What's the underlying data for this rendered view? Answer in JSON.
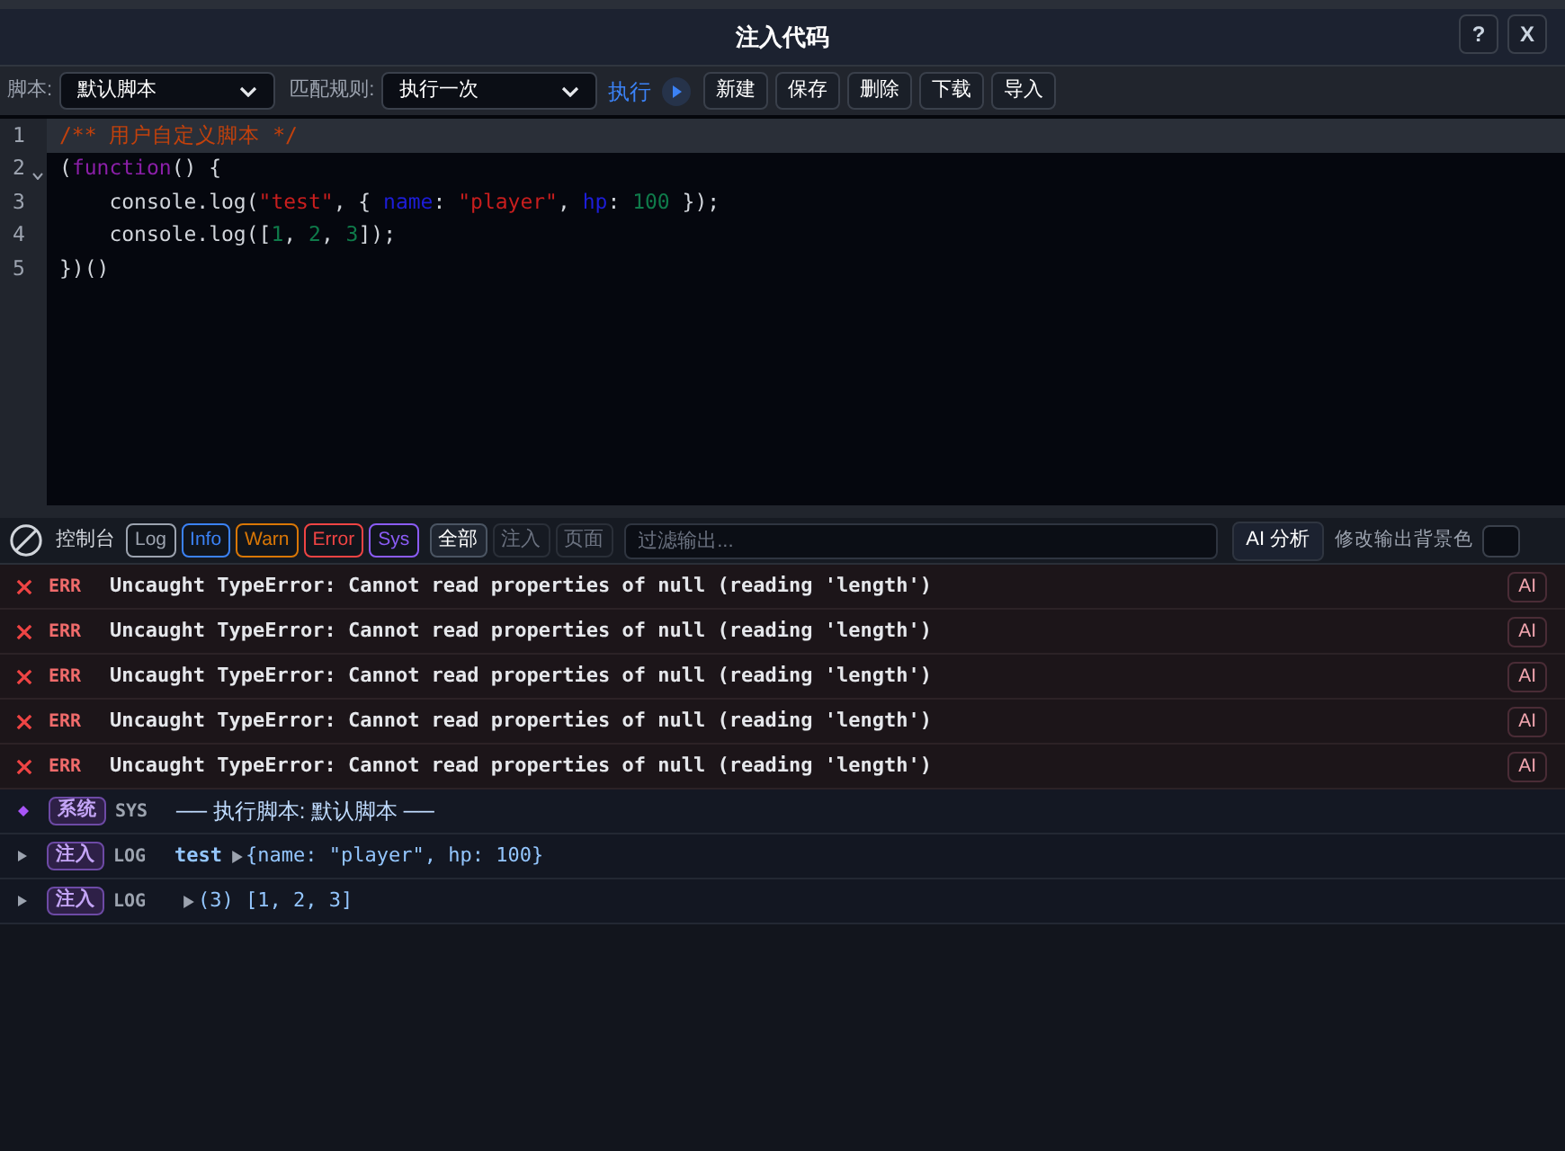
{
  "window": {
    "title": "注入代码",
    "buttons": [
      "?",
      "X"
    ]
  },
  "toolbar": {
    "script_label": "脚本:",
    "script_value": "默认脚本",
    "rule_label": "匹配规则:",
    "rule_value": "执行一次",
    "run_label": "执行",
    "buttons": [
      "新建",
      "保存",
      "删除",
      "下载",
      "导入"
    ]
  },
  "editor": {
    "lines": [
      {
        "number": "1",
        "active": true,
        "foldable": false,
        "tokens": [
          {
            "kind": "comment",
            "text": "/** 用户自定义脚本 */"
          }
        ]
      },
      {
        "number": "2",
        "active": false,
        "foldable": true,
        "tokens": [
          {
            "kind": "plain",
            "text": "("
          },
          {
            "kind": "keyword",
            "text": "function"
          },
          {
            "kind": "plain",
            "text": "() {"
          }
        ]
      },
      {
        "number": "3",
        "active": false,
        "foldable": false,
        "tokens": [
          {
            "kind": "plain",
            "text": "    console.log("
          },
          {
            "kind": "string",
            "text": "\"test\""
          },
          {
            "kind": "plain",
            "text": ", { "
          },
          {
            "kind": "property",
            "text": "name"
          },
          {
            "kind": "plain",
            "text": ": "
          },
          {
            "kind": "string",
            "text": "\"player\""
          },
          {
            "kind": "plain",
            "text": ", "
          },
          {
            "kind": "property",
            "text": "hp"
          },
          {
            "kind": "plain",
            "text": ": "
          },
          {
            "kind": "number",
            "text": "100"
          },
          {
            "kind": "plain",
            "text": " });"
          }
        ]
      },
      {
        "number": "4",
        "active": false,
        "foldable": false,
        "tokens": [
          {
            "kind": "plain",
            "text": "    console.log(["
          },
          {
            "kind": "number",
            "text": "1"
          },
          {
            "kind": "plain",
            "text": ", "
          },
          {
            "kind": "number",
            "text": "2"
          },
          {
            "kind": "plain",
            "text": ", "
          },
          {
            "kind": "number",
            "text": "3"
          },
          {
            "kind": "plain",
            "text": "]);"
          }
        ]
      },
      {
        "number": "5",
        "active": false,
        "foldable": false,
        "tokens": [
          {
            "kind": "plain",
            "text": "})()"
          }
        ]
      }
    ]
  },
  "console": {
    "title": "控制台",
    "levels": [
      {
        "label": "Log",
        "color": "#9ca3af"
      },
      {
        "label": "Info",
        "color": "#3b82f6"
      },
      {
        "label": "Warn",
        "color": "#d97706"
      },
      {
        "label": "Error",
        "color": "#ef4444"
      },
      {
        "label": "Sys",
        "color": "#8b5cf6"
      }
    ],
    "sources": [
      {
        "label": "全部",
        "selected": true
      },
      {
        "label": "注入",
        "selected": false
      },
      {
        "label": "页面",
        "selected": false
      }
    ],
    "filter_placeholder": "过滤输出...",
    "ai_button": "AI 分析",
    "bg_label": "修改输出背景色",
    "entries": [
      {
        "kind": "error",
        "level": "ERR",
        "message": "Uncaught TypeError: Cannot read properties of null (reading 'length')",
        "action": "AI"
      },
      {
        "kind": "error",
        "level": "ERR",
        "message": "Uncaught TypeError: Cannot read properties of null (reading 'length')",
        "action": "AI"
      },
      {
        "kind": "error",
        "level": "ERR",
        "message": "Uncaught TypeError: Cannot read properties of null (reading 'length')",
        "action": "AI"
      },
      {
        "kind": "error",
        "level": "ERR",
        "message": "Uncaught TypeError: Cannot read properties of null (reading 'length')",
        "action": "AI"
      },
      {
        "kind": "error",
        "level": "ERR",
        "message": "Uncaught TypeError: Cannot read properties of null (reading 'length')",
        "action": "AI"
      },
      {
        "kind": "system",
        "tag": "系统",
        "level": "SYS",
        "message": "── 执行脚本: 默认脚本 ──"
      },
      {
        "kind": "log",
        "tag": "注入",
        "level": "LOG",
        "text": "test",
        "object": "{name: \"player\", hp: 100}"
      },
      {
        "kind": "log",
        "tag": "注入",
        "level": "LOG",
        "object": "(3) [1, 2, 3]"
      }
    ]
  }
}
